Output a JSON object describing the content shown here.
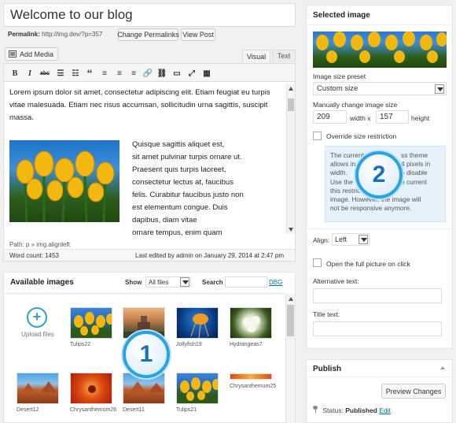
{
  "post": {
    "title": "Welcome to our blog",
    "permalink_label": "Permalink:",
    "permalink_url": "http://img.dev/?p=357",
    "change_permalinks": "Change Permalinks",
    "view_post": "View Post",
    "add_media": "Add Media",
    "tab_visual": "Visual",
    "tab_text": "Text"
  },
  "editor": {
    "paragraph1": "Lorem ipsum dolor sit amet, consectetur adipiscing elit. Etiam feugiat eu turpis vitae malesuada. Etiam nec risus accumsan, sollicitudin urna sagittis, suscipit massa.",
    "float_lines": [
      "Quisque sagittis aliquet est,",
      "sit amet pulvinar turpis ornare ut.",
      "Praesent quis turpis laoreet,",
      "consectetur lectus at, faucibus",
      "felis. Curabitur faucibus justo non",
      "est elementum congue. Duis",
      "dapibus, diam vitae",
      "ornare tempus, enim quam"
    ],
    "path": "Path: p » img.alignleft",
    "word_count": "Word count: 1453",
    "last_edited": "Last edited by admin on January 29, 2014 at 2:47 pm"
  },
  "library": {
    "title": "Available images",
    "show_label": "Show",
    "show_value": "All files",
    "search_label": "Search",
    "search_link": "DBG",
    "upload_label": "Upload files",
    "items": [
      {
        "label": "Tulips22"
      },
      {
        "label": ""
      },
      {
        "label": "Jollyfish19"
      },
      {
        "label": "Hydrangeas7"
      },
      {
        "label": "Desert12"
      },
      {
        "label": "Chrysanthemum26"
      },
      {
        "label": "Desert11"
      },
      {
        "label": "Tulips21"
      },
      {
        "label": "Chrysanthemum25"
      }
    ]
  },
  "selected": {
    "title": "Selected image",
    "preset_label": "Image size preset",
    "preset_value": "Custom size",
    "manual_label": "Manually change image size",
    "width_value": "209",
    "width_label": "width x",
    "height_value": "157",
    "height_label": "height",
    "override_label": "Override size restriction",
    "note_lines": [
      "The current",
      "allows in",
      "width.",
      "Use the",
      "this restric",
      "image. However, the image will",
      "not be responsive anymore."
    ],
    "note_right": [
      "ss theme",
      "4 pixels in",
      "",
      "o disable",
      "e current",
      "",
      ""
    ],
    "align_label": "Align:",
    "align_value": "Left",
    "open_full_label": "Open the full picture on click",
    "alt_label": "Alternative text:",
    "title_label": "Title text:"
  },
  "publish": {
    "title": "Publish",
    "preview": "Preview Changes",
    "status_label": "Status:",
    "status_value": "Published",
    "edit": "Edit"
  },
  "badges": {
    "one": "1",
    "two": "2"
  },
  "colors": {
    "accent": "#29a4e3",
    "link": "#0074a2",
    "note_bg": "#e5f2fc"
  }
}
